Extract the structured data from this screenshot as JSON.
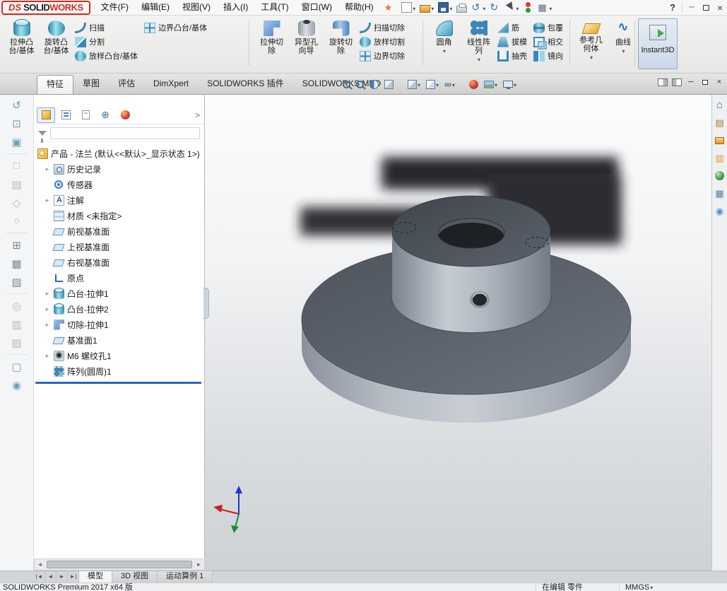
{
  "titlebar": {
    "logo_ds": "DS",
    "logo_solid": "SOLID",
    "logo_works": "WORKS",
    "menus": [
      "文件(F)",
      "编辑(E)",
      "视图(V)",
      "插入(I)",
      "工具(T)",
      "窗口(W)",
      "帮助(H)"
    ],
    "help": "?"
  },
  "ribbon": {
    "extruded_boss": [
      "拉伸凸",
      "台/基体"
    ],
    "revolved_boss": [
      "旋转凸",
      "台/基体"
    ],
    "sweep": "扫描",
    "split": "分割",
    "loft": "放样凸台/基体",
    "boundary_boss": "边界凸台/基体",
    "extruded_cut": [
      "拉伸切",
      "除"
    ],
    "hole_wizard": [
      "异型孔",
      "向导"
    ],
    "revolved_cut": [
      "旋转切",
      "除"
    ],
    "swept_cut": "扫描切除",
    "lofted_cut": "放样切割",
    "boundary_cut": "边界切除",
    "fillet": "圆角",
    "linear_pattern": [
      "线性阵",
      "列"
    ],
    "rib": "筋",
    "draft": "拔模",
    "shell": "抽壳",
    "wrap": "包覆",
    "intersect": "相交",
    "mirror": "镜向",
    "reference_geometry": [
      "参考几",
      "何体"
    ],
    "curves": "曲线",
    "instant3d": "Instant3D"
  },
  "tabs": [
    "特征",
    "草图",
    "评估",
    "DimXpert",
    "SOLIDWORKS 插件",
    "SOLIDWORKS MBD"
  ],
  "tree": {
    "root_label": "产品 - 法兰 (默认<<默认>_显示状态 1>)",
    "items": [
      "历史记录",
      "传感器",
      "注解",
      "材质 <未指定>",
      "前视基准面",
      "上视基准面",
      "右视基准面",
      "原点",
      "凸台-拉伸1",
      "凸台-拉伸2",
      "切除-拉伸1",
      "基准面1",
      "M6 螺纹孔1",
      "阵列(圆周)1"
    ]
  },
  "bottom_tabs": [
    "模型",
    "3D 视图",
    "运动算例 1"
  ],
  "statusbar": {
    "product": "SOLIDWORKS Premium 2017 x64 版",
    "mode": "在编辑 零件",
    "units": "MMGS"
  },
  "colors": {
    "accent_red": "#d52b1e",
    "rollback_blue": "#2a62c9"
  }
}
